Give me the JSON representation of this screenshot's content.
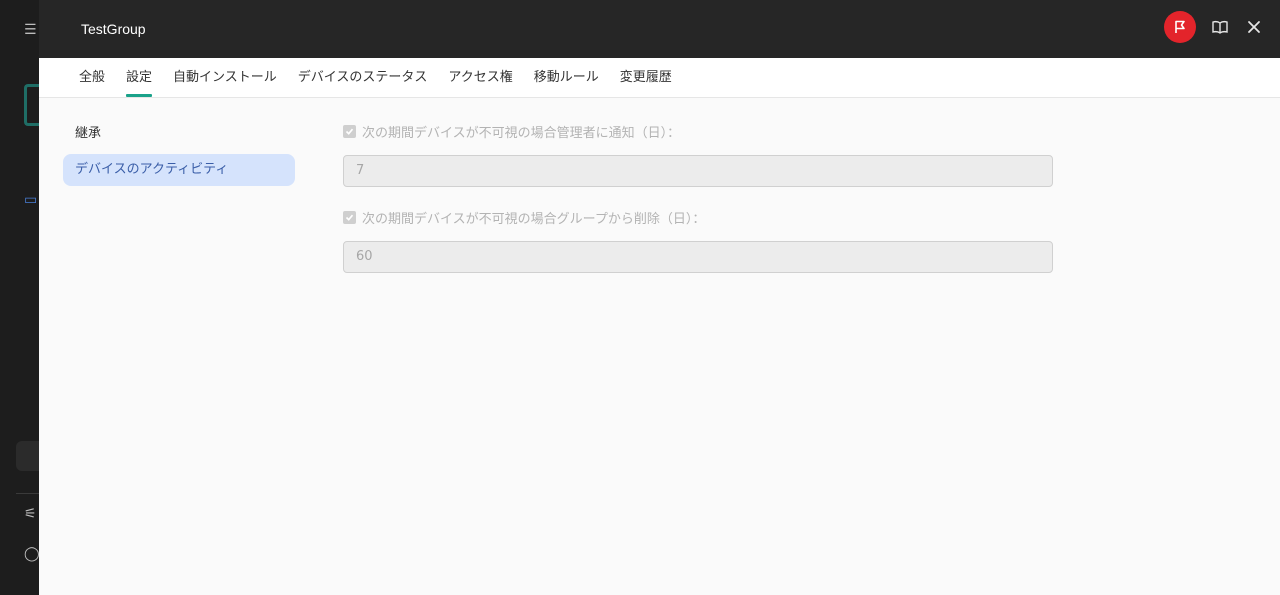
{
  "panel": {
    "title": "TestGroup"
  },
  "header_actions": {
    "flag_color": "#e3242b"
  },
  "tabs": [
    {
      "label": "全般"
    },
    {
      "label": "設定",
      "active": true
    },
    {
      "label": "自動インストール"
    },
    {
      "label": "デバイスのステータス"
    },
    {
      "label": "アクセス権"
    },
    {
      "label": "移動ルール"
    },
    {
      "label": "変更履歴"
    }
  ],
  "left_nav": [
    {
      "label": "継承"
    },
    {
      "label": "デバイスのアクティビティ",
      "active": true
    }
  ],
  "form": {
    "notify": {
      "label": "次の期間デバイスが不可視の場合管理者に通知（日）：",
      "checked": true,
      "value": "7"
    },
    "remove": {
      "label": "次の期間デバイスが不可視の場合グループから削除（日）：",
      "checked": true,
      "value": "60"
    }
  },
  "colors": {
    "accent": "#1aa28a",
    "selected_nav_bg": "#d5e3fc"
  }
}
